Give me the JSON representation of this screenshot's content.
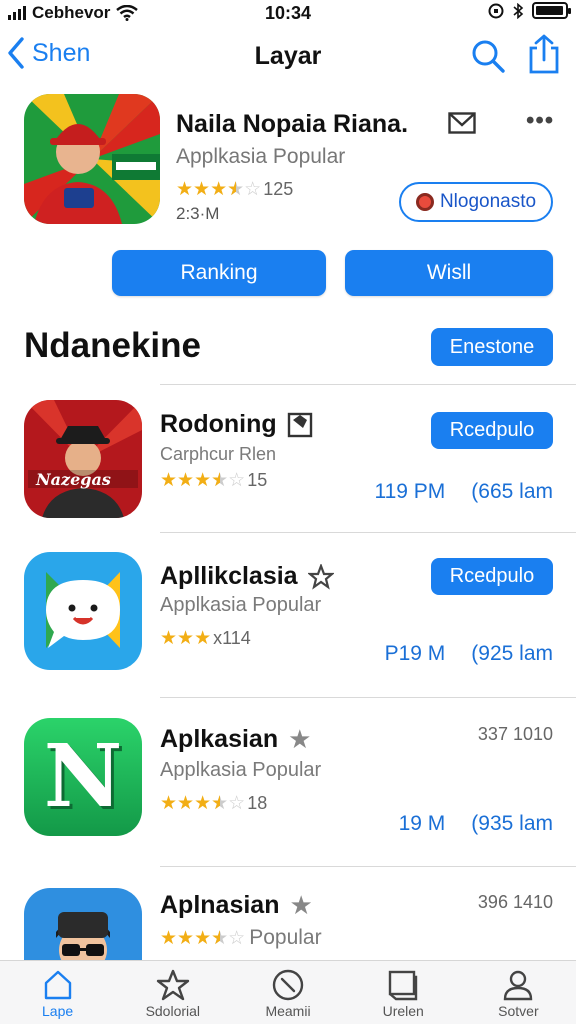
{
  "status_bar": {
    "carrier": "Cebhevor",
    "time": "10:34",
    "battery_level": 0.95
  },
  "nav": {
    "back_label": "Shen",
    "title": "Layar",
    "icons": [
      "chevron-left-icon",
      "search-icon",
      "share-icon"
    ]
  },
  "hero": {
    "title": "Naila Nopaia Riana.",
    "subtitle": "Applkasia Popular",
    "rating_stars": 3.5,
    "rating_count": "125",
    "time": "2:3·M",
    "chip_label": "Nlogonasto",
    "buttons": [
      "Ranking",
      "Wisll"
    ]
  },
  "section": {
    "title": "Ndanekine",
    "action_label": "Enestone"
  },
  "apps": [
    {
      "name": "Rodoning",
      "subtitle": "Carphcur Rlen",
      "rating_stars": 3.5,
      "rating_text": "15",
      "button_label": "Rcedpulo",
      "time": "119 PM",
      "size": "(665 lam",
      "icon_text": "Nazegas"
    },
    {
      "name": "Apllikclasia",
      "subtitle": "Applkasia Popular",
      "rating_stars": 3,
      "rating_text": "x114",
      "button_label": "Rcedpulo",
      "time": "P19 M",
      "size": "(925 lam"
    },
    {
      "name": "Aplkasian",
      "subtitle": "Applkasia Popular",
      "rating_stars": 3.5,
      "rating_text": "18",
      "number": "337 1010",
      "time": "19 M",
      "size": "(935 lam",
      "icon_text": "N"
    },
    {
      "name": "Aplnasian",
      "subtitle": "Popular",
      "rating_stars": 3.5,
      "number": "396 1410"
    }
  ],
  "tabs": [
    {
      "label": "Lape",
      "icon": "home-icon",
      "active": true
    },
    {
      "label": "Sdolorial",
      "icon": "star-icon",
      "active": false
    },
    {
      "label": "Meamii",
      "icon": "clock-icon",
      "active": false
    },
    {
      "label": "Urelen",
      "icon": "screen-icon",
      "active": false
    },
    {
      "label": "Sotver",
      "icon": "person-icon",
      "active": false
    }
  ],
  "colors": {
    "accent": "#1a7ff0",
    "star": "#f2ae15",
    "meta_text": "#1a6fd6"
  }
}
